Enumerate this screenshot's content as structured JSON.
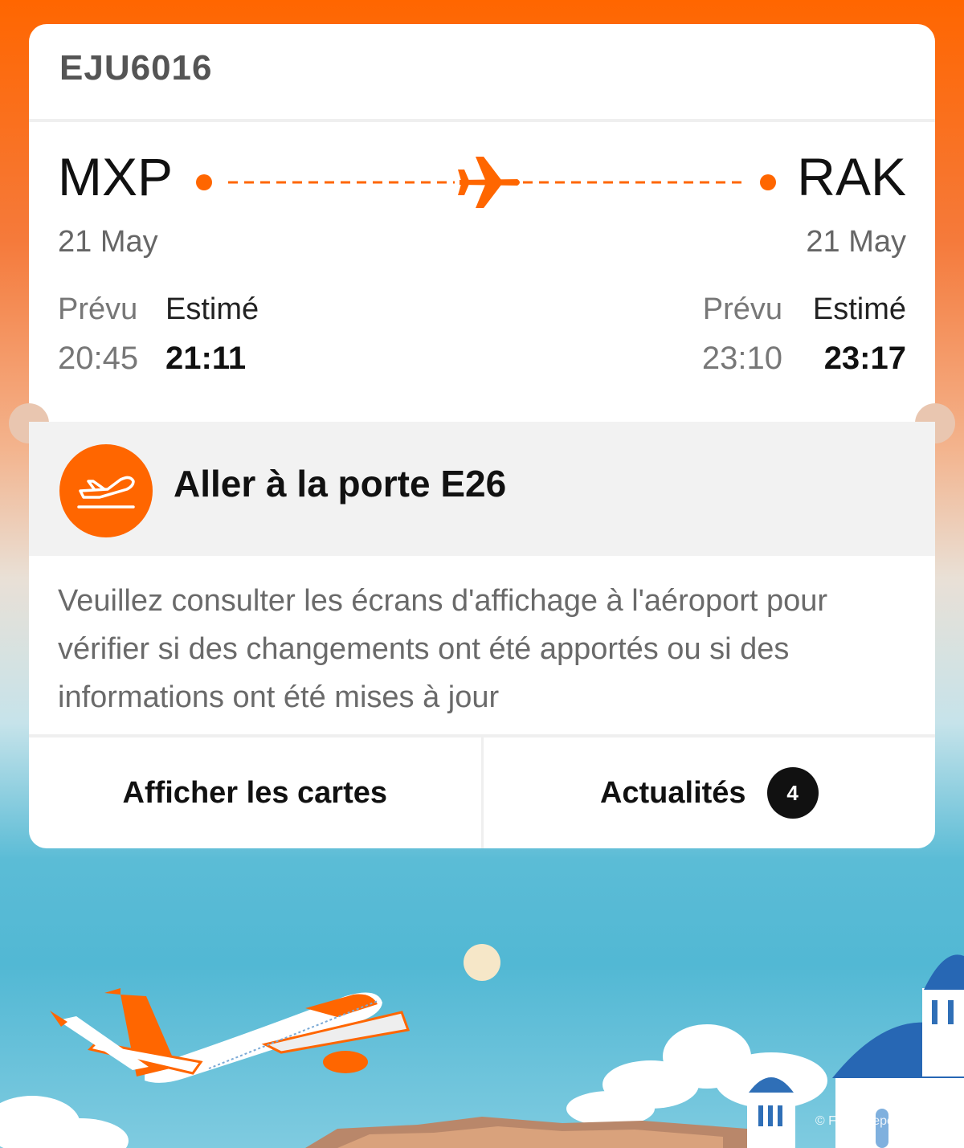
{
  "flight": {
    "number": "EJU6016"
  },
  "origin": {
    "code": "MXP",
    "date": "21 May",
    "scheduled_label": "Prévu",
    "estimated_label": "Estimé",
    "scheduled_time": "20:45",
    "estimated_time": "21:11"
  },
  "destination": {
    "code": "RAK",
    "date": "21 May",
    "scheduled_label": "Prévu",
    "estimated_label": "Estimé",
    "scheduled_time": "23:10",
    "estimated_time": "23:17"
  },
  "gate": {
    "message": "Aller à la porte E26",
    "icon": "plane-departure-icon"
  },
  "info": {
    "text": "Veuillez consulter les écrans d'affichage à l'aéroport pour vérifier si des changements ont été apportés ou si des informations ont été mises à jour"
  },
  "actions": {
    "cards_label": "Afficher les cartes",
    "news_label": "Actualités",
    "news_count": "4"
  },
  "footer": {
    "copyright": "© Flight Report - Enivit"
  },
  "colors": {
    "brand": "#ff6600",
    "card": "#ffffff",
    "band": "#f2f2f2"
  }
}
